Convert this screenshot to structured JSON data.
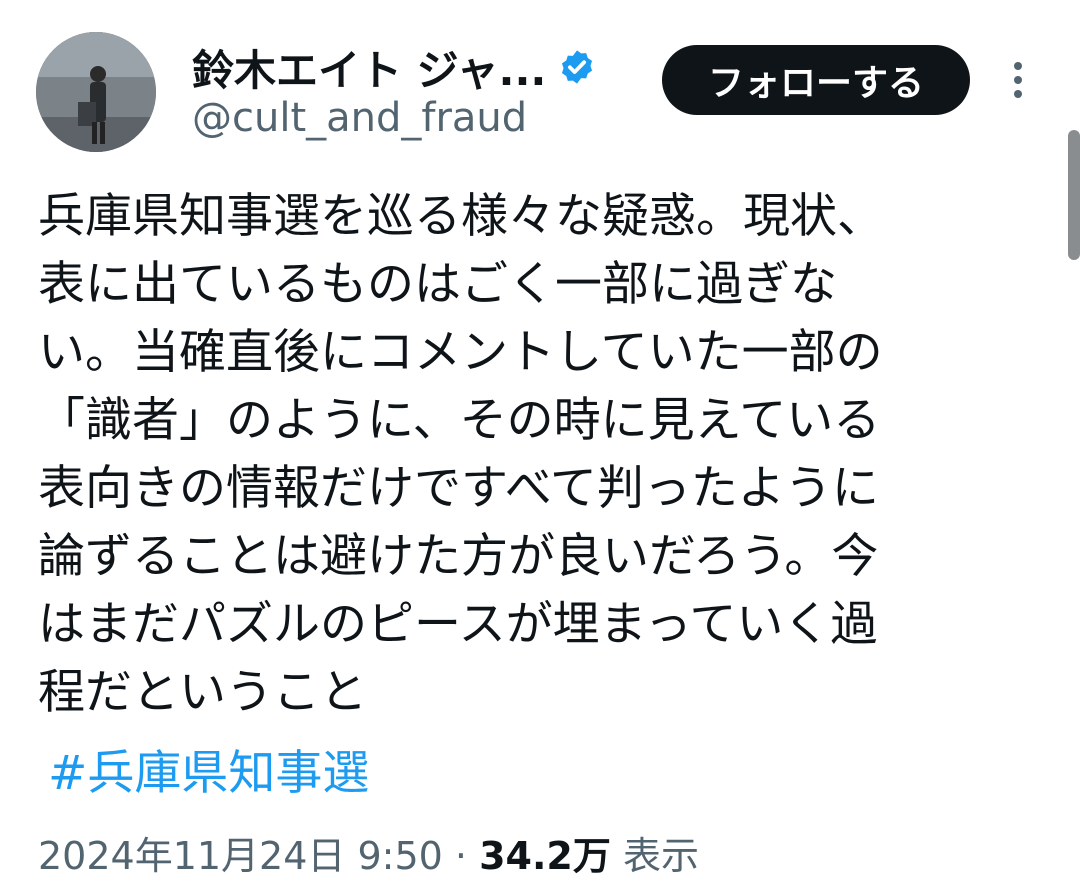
{
  "author": {
    "display_name": "鈴木エイト ジャ...",
    "handle": "@cult_and_fraud",
    "verified_icon": "verified-badge-icon",
    "avatar_icon": "avatar-photo"
  },
  "actions": {
    "follow_label": "フォローする",
    "more_icon": "more-vertical-icon"
  },
  "tweet": {
    "lines": [
      "兵庫県知事選を巡る様々な疑惑。現状、",
      "表に出ているものはごく一部に過ぎな",
      "い。当確直後にコメントしていた一部の",
      "「識者」のように、その時に見えている",
      "表向きの情報だけですべて判ったように",
      "論ずることは避けた方が良いだろう。今",
      "はまだパズルのピースが埋まっていく過",
      "程だということ"
    ],
    "hashtag": "#兵庫県知事選"
  },
  "meta": {
    "timestamp": "2024年11月24日 9:50",
    "separator": "·",
    "views_count": "34.2万",
    "views_label": "表示"
  },
  "colors": {
    "text": "#0f1419",
    "secondary": "#536471",
    "accent": "#1d9bf0",
    "button_bg": "#0f1419"
  }
}
